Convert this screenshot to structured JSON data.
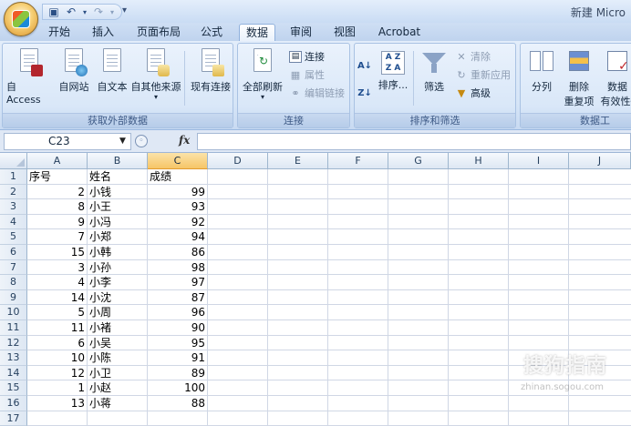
{
  "window": {
    "title": "新建 Micro"
  },
  "quick_access": {
    "more": "▾"
  },
  "tabs": [
    {
      "label": "开始"
    },
    {
      "label": "插入"
    },
    {
      "label": "页面布局"
    },
    {
      "label": "公式"
    },
    {
      "label": "数据"
    },
    {
      "label": "审阅"
    },
    {
      "label": "视图"
    },
    {
      "label": "Acrobat"
    }
  ],
  "ribbon": {
    "external": {
      "label": "获取外部数据",
      "access": "自 Access",
      "web": "自网站",
      "text": "自文本",
      "other": "自其他来源",
      "other_arrow": "▾",
      "existing": "现有连接"
    },
    "connections": {
      "label": "连接",
      "refresh": "全部刷新",
      "refresh_arrow": "▾",
      "conn": "连接",
      "props": "属性",
      "edit_links": "编辑链接"
    },
    "sort_filter": {
      "label": "排序和筛选",
      "sort": "排序...",
      "filter": "筛选",
      "clear": "清除",
      "reapply": "重新应用",
      "advanced": "高级"
    },
    "tools": {
      "label": "数据工",
      "split": "分列",
      "remove_dup_1": "删除",
      "remove_dup_2": "重复项",
      "validation_1": "数据",
      "validation_2": "有效性",
      "validation_arrow": "▾"
    }
  },
  "formula_bar": {
    "name_box": "C23",
    "fx": "fx",
    "formula": ""
  },
  "sheet": {
    "columns": [
      "A",
      "B",
      "C",
      "D",
      "E",
      "F",
      "G",
      "H",
      "I",
      "J"
    ],
    "selected_column": "C",
    "rows": [
      "1",
      "2",
      "3",
      "4",
      "5",
      "6",
      "7",
      "8",
      "9",
      "10",
      "11",
      "12",
      "13",
      "14",
      "15",
      "16",
      "17"
    ],
    "header": [
      "序号",
      "姓名",
      "成绩"
    ],
    "data": [
      [
        "2",
        "小钱",
        "99"
      ],
      [
        "8",
        "小王",
        "93"
      ],
      [
        "9",
        "小冯",
        "92"
      ],
      [
        "7",
        "小郑",
        "94"
      ],
      [
        "15",
        "小韩",
        "86"
      ],
      [
        "3",
        "小孙",
        "98"
      ],
      [
        "4",
        "小李",
        "97"
      ],
      [
        "14",
        "小沈",
        "87"
      ],
      [
        "5",
        "小周",
        "96"
      ],
      [
        "11",
        "小褚",
        "90"
      ],
      [
        "6",
        "小吴",
        "95"
      ],
      [
        "10",
        "小陈",
        "91"
      ],
      [
        "12",
        "小卫",
        "89"
      ],
      [
        "1",
        "小赵",
        "100"
      ],
      [
        "13",
        "小蒋",
        "88"
      ]
    ]
  },
  "watermark": {
    "text": "搜狗指南",
    "sub": "zhinan.sogou.com"
  }
}
